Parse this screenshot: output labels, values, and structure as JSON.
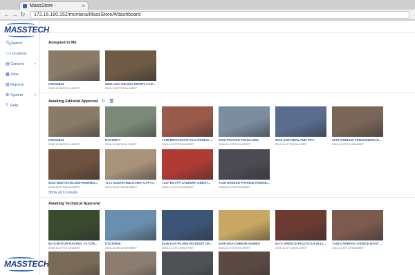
{
  "browser": {
    "tab_title": "MassStore -",
    "tab_close": "×",
    "url": "172.16.180.152/montana/MassStore/#/dashboard",
    "back": "←",
    "forward": "→",
    "reload": "↻"
  },
  "brand": {
    "name": "MASSTECH"
  },
  "sidebar": {
    "items": [
      {
        "label": "Search",
        "icon": "🔍",
        "has_chevron": false
      },
      {
        "label": "Locations",
        "icon": "▭",
        "has_chevron": false
      },
      {
        "label": "Content",
        "icon": "▤",
        "has_chevron": true
      },
      {
        "label": "Jobs",
        "icon": "▦",
        "has_chevron": false
      },
      {
        "label": "Reports",
        "icon": "▥",
        "has_chevron": false
      },
      {
        "label": "System",
        "icon": "⚙",
        "has_chevron": true
      },
      {
        "label": "Help",
        "icon": "?",
        "has_chevron": false
      }
    ],
    "chevron": "›"
  },
  "sections": {
    "assigned": {
      "title": "Assigned to Me",
      "cards": [
        {
          "title": "DSC00834",
          "date": "2015-12-08T22:11:01EET",
          "color": "#8a7b67"
        },
        {
          "title": "5205-USA-OBAMA-KENNY-CAP...",
          "date": "2015-12-07T23:54:18EET",
          "color": "#6f5a45"
        }
      ]
    },
    "editorial": {
      "title": "Awaiting Editorial Approval",
      "refresh_icon": "↻",
      "delete_icon": "🗑",
      "cards": [
        {
          "title": "DSC00834",
          "date": "2015-12-08T22:11:01EET",
          "color": "#8a7b67"
        },
        {
          "title": "DSC00877",
          "date": "2015-12-08T22:11:00EET",
          "color": "#7b8a78"
        },
        {
          "title": "7145-BRITAIN ROYALS PRINCE ...",
          "date": "2015-12-07T23:54:10EET",
          "color": "#9a5a4a"
        },
        {
          "title": "5152-FRANCE-TELECOMS",
          "date": "2015-12-07T23:54:10EET",
          "color": "#7d8da0"
        },
        {
          "title": "5141-SWITZERLAND-FIFA",
          "date": "2015-12-07T23:54:13EET",
          "color": "#5a6d8f"
        },
        {
          "title": "4179-GREECE-PENSIONERS-D...",
          "date": "2015-12-07T23:54:13EET",
          "color": "#7a6658"
        },
        {
          "title": "5133-DEUTSCHLAND-HOENES...",
          "date": "2015-12-07T23:54:10EET",
          "color": "#6e5240"
        },
        {
          "title": "7171-SUDAN-BULGARIA CAPTI...",
          "date": "2015-12-07T23:54:10EET",
          "color": "#a8927a"
        },
        {
          "title": "7137-EGYPT-JAZEERA GREST...",
          "date": "2015-12-07T23:54:08EET",
          "color": "#b03a34"
        },
        {
          "title": "7146-GREECE-FRANCE ROUND...",
          "date": "2015-12-07T23:54:04EET",
          "color": "#4c4a52"
        }
      ],
      "show_all": "Show all 12 results"
    },
    "technical": {
      "title": "Awaiting Technical Approval",
      "cards": [
        {
          "title": "6174-MOTOR RACING_F1-TOR...",
          "date": "2015-12-17T17:34:30EET",
          "color": "#3a4a2e"
        },
        {
          "title": "DSC00946",
          "date": "2015-12-08T22:10:58EET",
          "color": "#6a8fae"
        },
        {
          "title": "5145-USA-PLANE INCIDENT UP...",
          "date": "2015-12-07T23:54:27EET",
          "color": "#3c5576"
        },
        {
          "title": "5209-USA-CHEESE-NAMES",
          "date": "2015-12-07T23:54:19EET",
          "color": "#c7a763"
        },
        {
          "title": "6172-GREECE-POLITICS-KALLI...",
          "date": "2015-12-07T23:54:14EET",
          "color": "#6b3b32"
        },
        {
          "title": "7143-CARNIVAL-VENICE BOAT ...",
          "date": "2015-12-07T23:54:08EET",
          "color": "#7d5a4e"
        },
        {
          "title": "",
          "date": "",
          "color": "#7a6a58"
        },
        {
          "title": "",
          "date": "",
          "color": "#8c7d70"
        },
        {
          "title": "",
          "date": "",
          "color": "#4e5256"
        },
        {
          "title": "",
          "date": "",
          "color": "#5b4a44"
        }
      ]
    }
  }
}
